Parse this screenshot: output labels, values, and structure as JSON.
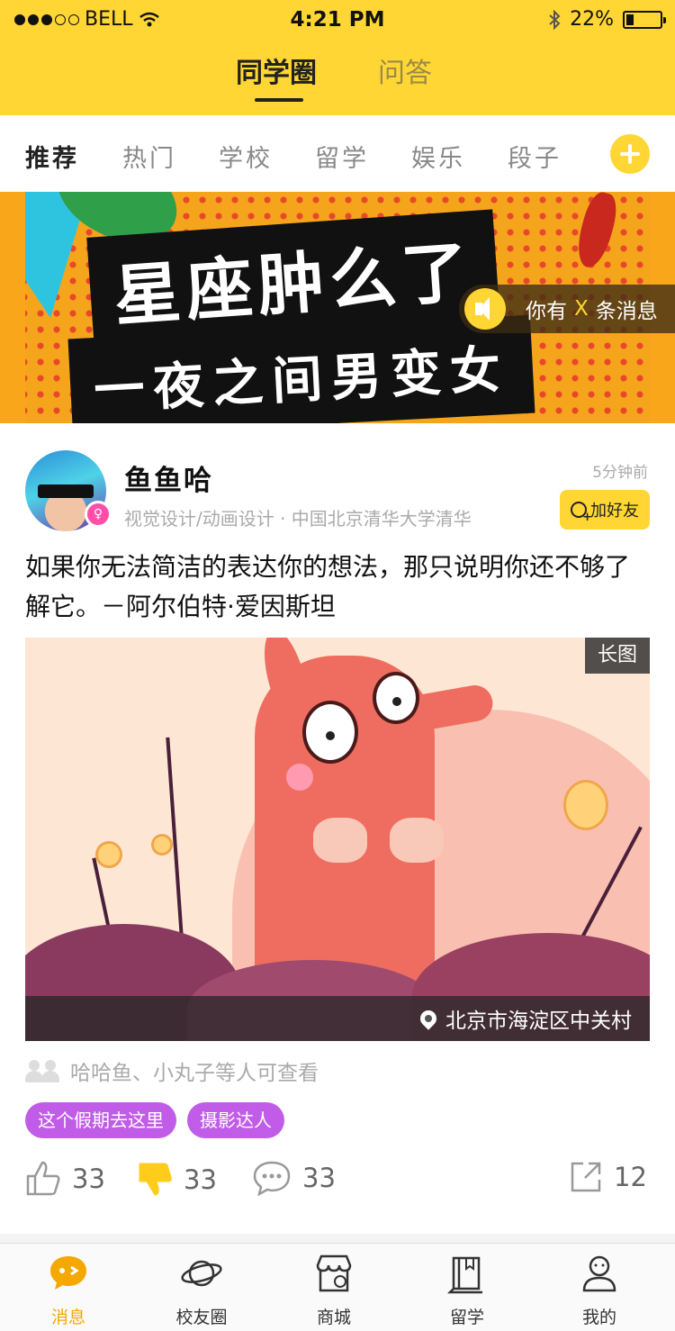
{
  "status_bar": {
    "carrier": "BELL",
    "time": "4:21 PM",
    "battery": "22%",
    "battery_level": 0.22,
    "signal_bars": 3,
    "signal_total": 5
  },
  "top_tabs": [
    {
      "label": "同学圈",
      "active": true
    },
    {
      "label": "问答",
      "active": false
    }
  ],
  "categories": [
    {
      "label": "推荐",
      "active": true
    },
    {
      "label": "热门",
      "active": false
    },
    {
      "label": "学校",
      "active": false
    },
    {
      "label": "留学",
      "active": false
    },
    {
      "label": "娱乐",
      "active": false
    },
    {
      "label": "段子",
      "active": false
    }
  ],
  "banner": {
    "line1": "星座肿么了",
    "line2": "一夜之间男变女",
    "notice_prefix": "你有",
    "notice_x": "X",
    "notice_suffix": "条消息"
  },
  "post": {
    "username": "鱼鱼哈",
    "gender_symbol": "♀",
    "meta": "视觉设计/动画设计 · 中国北京清华大学清华",
    "time_ago": "5分钟前",
    "add_friend": "加好友",
    "text": "如果你无法简洁的表达你的想法，那只说明你还不够了解它。－阿尔伯特·爱因斯坦",
    "image_badge": "长图",
    "location": "北京市海淀区中关村",
    "visible_to": "哈哈鱼、小丸子等人可查看",
    "tags": [
      "这个假期去这里",
      "摄影达人"
    ],
    "likes": "33",
    "dislikes": "33",
    "comments": "33",
    "shares": "12"
  },
  "tabbar": [
    {
      "label": "消息",
      "icon": "message-icon",
      "active": true
    },
    {
      "label": "校友圈",
      "icon": "planet-icon",
      "active": false
    },
    {
      "label": "商城",
      "icon": "store-icon",
      "active": false
    },
    {
      "label": "留学",
      "icon": "book-icon",
      "active": false
    },
    {
      "label": "我的",
      "icon": "profile-icon",
      "active": false
    }
  ],
  "colors": {
    "brand_yellow": "#ffd633",
    "tag_purple": "#c15ce8",
    "active_tab": "#f5a800"
  }
}
